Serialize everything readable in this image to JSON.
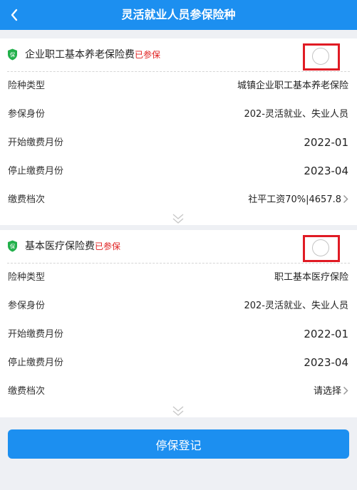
{
  "header": {
    "title": "灵活就业人员参保险种"
  },
  "cards": [
    {
      "name": "企业职工基本养老保险费",
      "tag": "已参保",
      "shield_text": "保",
      "rows": [
        {
          "label": "险种类型",
          "value": "城镇企业职工基本养老保险"
        },
        {
          "label": "参保身份",
          "value": "202-灵活就业、失业人员"
        },
        {
          "label": "开始缴费月份",
          "value": "2022-01"
        },
        {
          "label": "停止缴费月份",
          "value": "2023-04"
        },
        {
          "label": "缴费档次",
          "value": "社平工资70%|4657.8"
        }
      ]
    },
    {
      "name": "基本医疗保险费",
      "tag": "已参保",
      "shield_text": "保",
      "rows": [
        {
          "label": "险种类型",
          "value": "职工基本医疗保险"
        },
        {
          "label": "参保身份",
          "value": "202-灵活就业、失业人员"
        },
        {
          "label": "开始缴费月份",
          "value": "2022-01"
        },
        {
          "label": "停止缴费月份",
          "value": "2023-04"
        },
        {
          "label": "缴费档次",
          "value": "请选择"
        }
      ]
    }
  ],
  "footer": {
    "submit_label": "停保登记"
  },
  "colors": {
    "primary": "#1c8ff0",
    "tag": "#e02020",
    "highlight": "#e01b24",
    "shield": "#22b04b"
  },
  "icons": [
    "back-arrow-icon",
    "shield-icon",
    "chevron-right-icon",
    "double-chevron-down-icon"
  ]
}
